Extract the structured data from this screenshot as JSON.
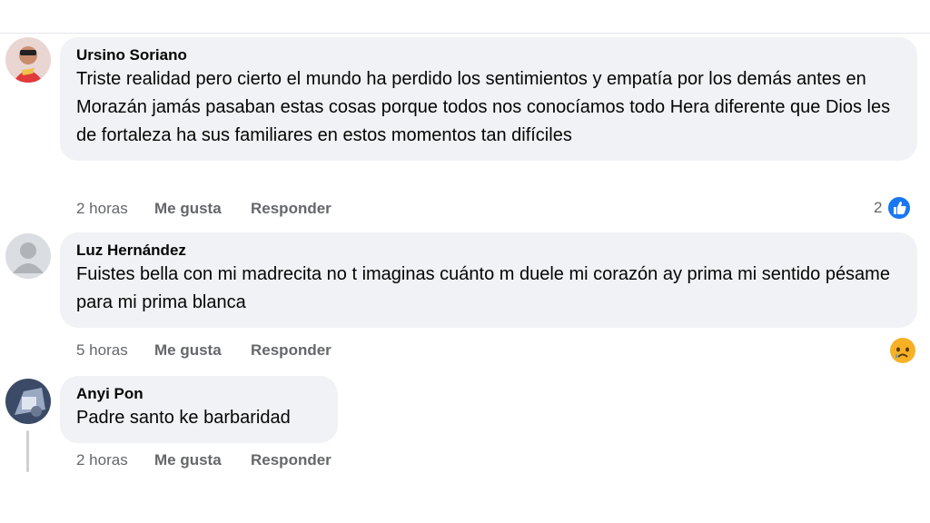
{
  "comments": [
    {
      "author": "Ursino Soriano",
      "text": "Triste realidad pero cierto el mundo ha perdido los sentimientos y empatía por los demás antes en Morazán jamás pasaban estas cosas porque todos nos conocíamos todo Hera diferente que Dios les de fortaleza ha sus familiares en estos momentos tan difíciles",
      "time": "2 horas",
      "like_label": "Me gusta",
      "reply_label": "Responder",
      "reaction_count": "2",
      "reaction_icon": "like-reaction-icon"
    },
    {
      "author": "Luz Hernández",
      "text": "Fuistes bella con mi madrecita no t imaginas cuánto m duele mi corazón ay prima mi sentido pésame para mi prima blanca",
      "time": "5 horas",
      "like_label": "Me gusta",
      "reply_label": "Responder",
      "reaction_icon": "sad-reaction-icon"
    },
    {
      "author": "Anyi Pon",
      "text": "Padre santo ke barbaridad",
      "time": "2 horas",
      "like_label": "Me gusta",
      "reply_label": "Responder"
    }
  ],
  "colors": {
    "bubble_bg": "#f0f2f5",
    "secondary_text": "#65676b",
    "like_blue": "#1877f2",
    "sad_yellow": "#f7b125"
  }
}
